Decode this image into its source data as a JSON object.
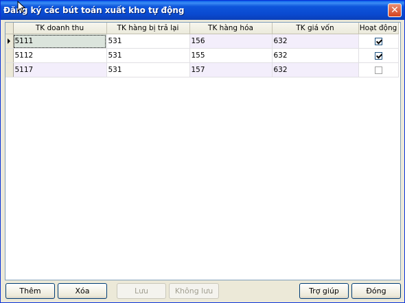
{
  "window": {
    "title": "Đăng ký các bút toán xuất kho tự động",
    "close_glyph": "✕"
  },
  "grid": {
    "columns": [
      "TK doanh thu",
      "TK hàng bị trả lại",
      "TK hàng hóa",
      "TK giá vốn",
      "Hoạt động"
    ],
    "rows": [
      {
        "tk_doanh_thu": "5111",
        "tk_hang_bi_tra_lai": "531",
        "tk_hang_hoa": "156",
        "tk_gia_von": "632",
        "hoat_dong": true
      },
      {
        "tk_doanh_thu": "5112",
        "tk_hang_bi_tra_lai": "531",
        "tk_hang_hoa": "155",
        "tk_gia_von": "632",
        "hoat_dong": true
      },
      {
        "tk_doanh_thu": "5117",
        "tk_hang_bi_tra_lai": "531",
        "tk_hang_hoa": "157",
        "tk_gia_von": "632",
        "hoat_dong": false
      }
    ]
  },
  "buttons": {
    "them": "Thêm",
    "xoa": "Xóa",
    "luu": "Lưu",
    "khong_luu": "Không lưu",
    "tro_giup": "Trợ giúp",
    "dong": "Đóng"
  }
}
